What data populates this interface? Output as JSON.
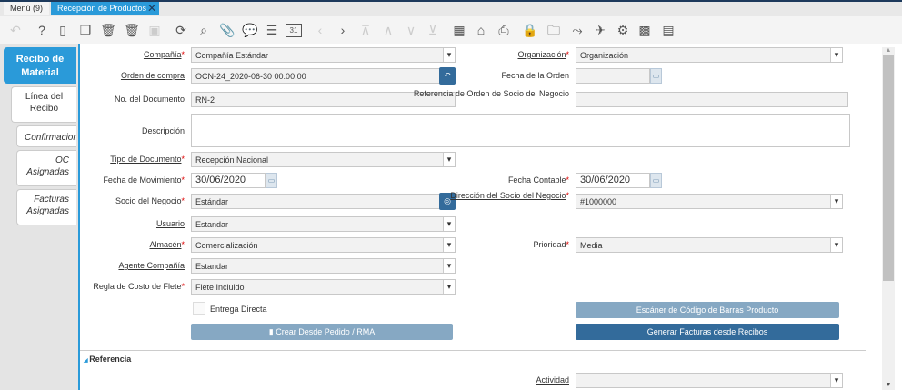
{
  "tabs": {
    "menu": "Menú (9)",
    "active": "Recepción de Productos"
  },
  "toolbar": [
    "undo-icon",
    "help-icon",
    "new-icon",
    "copy-icon",
    "delete-icon",
    "delete-selection-icon",
    "save-icon",
    "refresh-icon",
    "find-icon",
    "attachment-icon",
    "chat-icon",
    "grid-toggle-icon",
    "calendar-icon",
    "previous-icon",
    "next-icon",
    "first-icon",
    "parent-icon",
    "detail-icon",
    "last-icon",
    "report-icon",
    "archive-icon",
    "print-icon",
    "lock-icon",
    "zoom-across-icon",
    "workflow-icon",
    "request-icon",
    "process-icon",
    "product-info-icon",
    "post-icon"
  ],
  "sidetabs": [
    "Recibo de Material",
    "Línea del Recibo",
    "Confirmacion",
    "OC Asignadas",
    "Facturas Asignadas"
  ],
  "fields": {
    "compania": {
      "label": "Compañía",
      "value": "Compañía Estándar"
    },
    "organizacion": {
      "label": "Organización",
      "value": "Organización"
    },
    "orden": {
      "label": "Orden de compra",
      "value": "OCN-24_2020-06-30 00:00:00"
    },
    "fecha_orden": {
      "label": "Fecha de la Orden",
      "value": ""
    },
    "nodoc": {
      "label": "No. del Documento",
      "value": "RN-2"
    },
    "ref": {
      "label": "Referencia de Orden de Socio del Negocio",
      "value": ""
    },
    "desc": {
      "label": "Descripción",
      "value": ""
    },
    "tipo": {
      "label": "Tipo de Documento",
      "value": "Recepción Nacional"
    },
    "fecha_mov": {
      "label": "Fecha de Movimiento",
      "value": "30/06/2020"
    },
    "fecha_cont": {
      "label": "Fecha Contable",
      "value": "30/06/2020"
    },
    "socio": {
      "label": "Socio del Negocio",
      "value": "Estándar"
    },
    "direccion": {
      "label": "Dirección del Socio del Negocio",
      "value": "#1000000"
    },
    "usuario": {
      "label": "Usuario",
      "value": "Estandar"
    },
    "almacen": {
      "label": "Almacén",
      "value": "Comercialización"
    },
    "prioridad": {
      "label": "Prioridad",
      "value": "Media"
    },
    "agente": {
      "label": "Agente Compañía",
      "value": "Estandar"
    },
    "flete": {
      "label": "Regla de Costo de Flete",
      "value": "Flete Incluido"
    },
    "entrega": {
      "label": "Entrega Directa"
    },
    "actividad": {
      "label": "Actividad",
      "value": ""
    }
  },
  "buttons": {
    "scanner": "Escáner de Código de Barras Producto",
    "crear": "Crear Desde Pedido / RMA",
    "generar": "Generar Facturas desde Recibos"
  },
  "section": "Referencia",
  "colors": {
    "accent": "#2a9ad9",
    "button": "#336b9b",
    "button_disabled": "#86a8c3"
  }
}
